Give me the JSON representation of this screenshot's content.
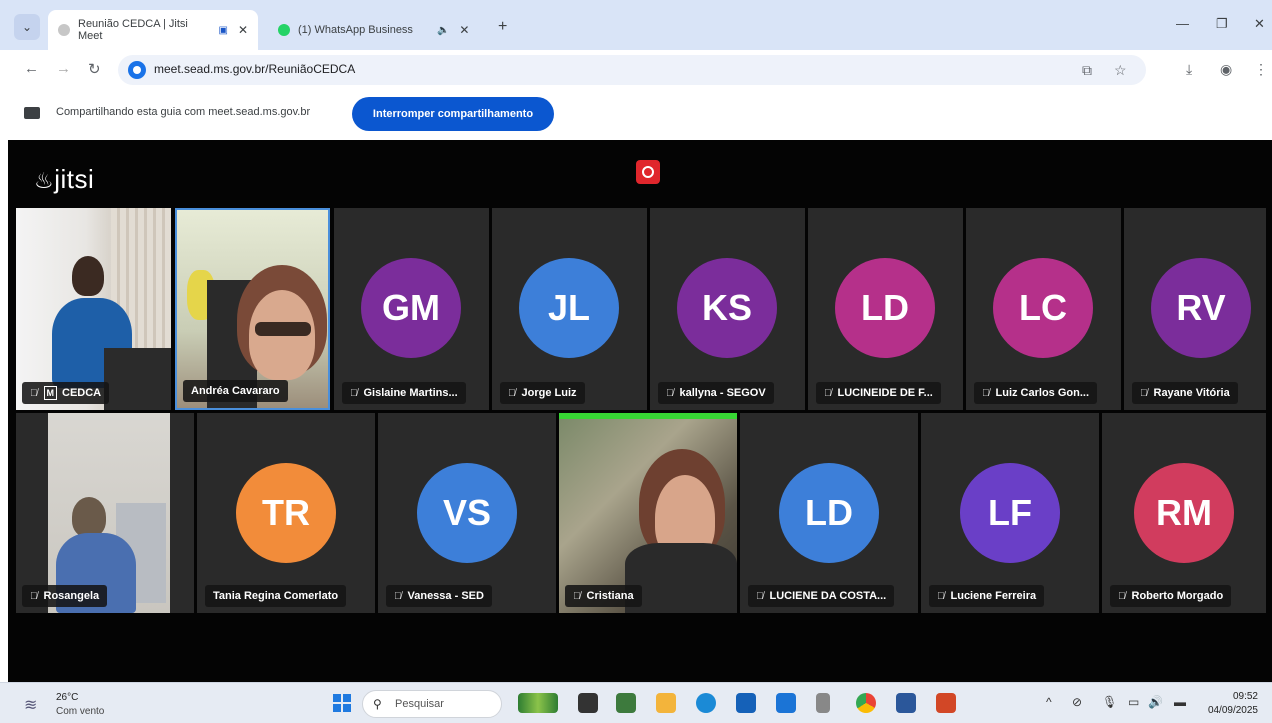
{
  "browser": {
    "tabs": [
      {
        "title": "Reunião CEDCA | Jitsi Meet",
        "active": true
      },
      {
        "title": "(1) WhatsApp Business",
        "active": false
      }
    ],
    "url": "meet.sead.ms.gov.br/ReuniãoCEDCA"
  },
  "sharebar": {
    "text": "Compartilhando esta guia com meet.sead.ms.gov.br",
    "button": "Interromper compartilhamento"
  },
  "meet": {
    "logo": "jitsi",
    "row1": [
      {
        "name": "CEDCA",
        "video": true,
        "moderator": true,
        "muted": true
      },
      {
        "name": "Andréa Cavararo",
        "video": true,
        "muted": false,
        "speaking": true
      },
      {
        "name": "Gislaine Martins...",
        "initials": "GM",
        "color": "#7b2d9b",
        "muted": true
      },
      {
        "name": "Jorge Luiz",
        "initials": "JL",
        "color": "#3d7fd9",
        "muted": true
      },
      {
        "name": "kallyna - SEGOV",
        "initials": "KS",
        "color": "#7b2d9b",
        "muted": true
      },
      {
        "name": "LUCINEIDE DE F...",
        "initials": "LD",
        "color": "#b5308a",
        "muted": true
      },
      {
        "name": "Luiz Carlos Gon...",
        "initials": "LC",
        "color": "#b5308a",
        "muted": true
      },
      {
        "name": "Rayane Vitória",
        "initials": "RV",
        "color": "#7b2d9b",
        "muted": true
      }
    ],
    "row2": [
      {
        "name": "Rosangela",
        "video": true,
        "muted": true
      },
      {
        "name": "Tania Regina Comerlato",
        "initials": "TR",
        "color": "#f28c3a",
        "muted": false
      },
      {
        "name": "Vanessa - SED",
        "initials": "VS",
        "color": "#3d7fd9",
        "muted": true
      },
      {
        "name": "Cristiana",
        "video": true,
        "muted": true
      },
      {
        "name": "LUCIENE DA COSTA...",
        "initials": "LD",
        "color": "#3d7fd9",
        "muted": true
      },
      {
        "name": "Luciene Ferreira",
        "initials": "LF",
        "color": "#6a3fc7",
        "muted": true
      },
      {
        "name": "Roberto Morgado",
        "initials": "RM",
        "color": "#d13c5e",
        "muted": true
      }
    ]
  },
  "taskbar": {
    "temperature": "26°C",
    "condition": "Com vento",
    "search_placeholder": "Pesquisar",
    "time": "09:52",
    "date": "04/09/2025"
  }
}
